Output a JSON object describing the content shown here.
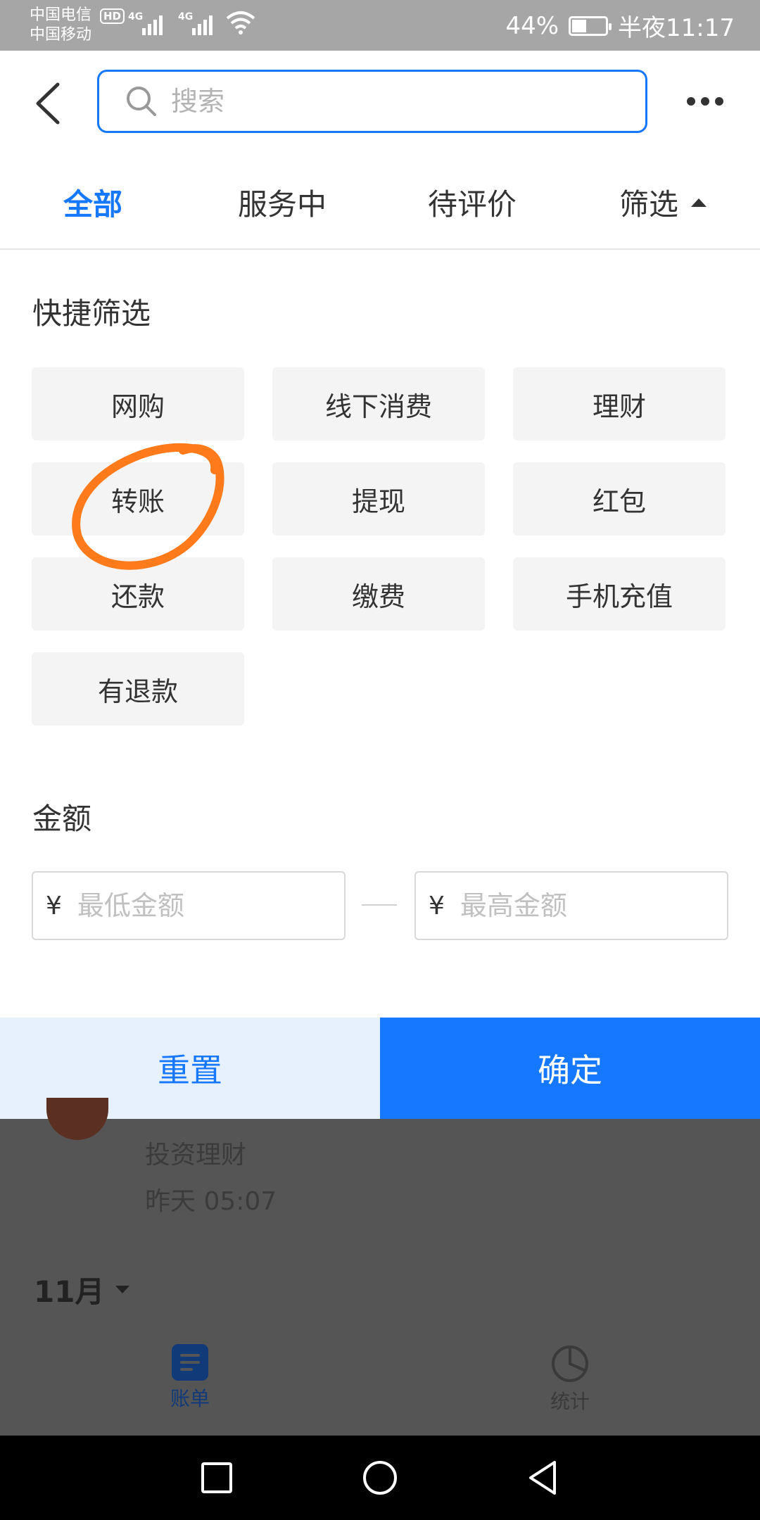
{
  "status_bar": {
    "carrier_1": "中国电信",
    "carrier_2": "中国移动",
    "hd_badge": "HD",
    "network_1": "4G",
    "network_2": "4G",
    "battery_percent": "44%",
    "battery_level": 0.44,
    "time": "半夜11:17"
  },
  "search": {
    "placeholder": "搜索"
  },
  "tabs": [
    {
      "label": "全部",
      "active": true
    },
    {
      "label": "服务中",
      "active": false
    },
    {
      "label": "待评价",
      "active": false
    },
    {
      "label": "筛选",
      "active": false
    }
  ],
  "quick_filter": {
    "title": "快捷筛选",
    "chips": [
      "网购",
      "线下消费",
      "理财",
      "转账",
      "提现",
      "红包",
      "还款",
      "缴费",
      "手机充值",
      "有退款"
    ]
  },
  "amount": {
    "title": "金额",
    "currency_symbol": "¥",
    "min_placeholder": "最低金额",
    "max_placeholder": "最高金额"
  },
  "actions": {
    "reset": "重置",
    "confirm": "确定"
  },
  "background_list": {
    "category": "投资理财",
    "time": "昨天  05:07",
    "month": "11月"
  },
  "bottom_nav": {
    "bill": "账单",
    "stats": "统计"
  },
  "colors": {
    "accent": "#1677ff",
    "annotation": "#ff7a1a"
  }
}
